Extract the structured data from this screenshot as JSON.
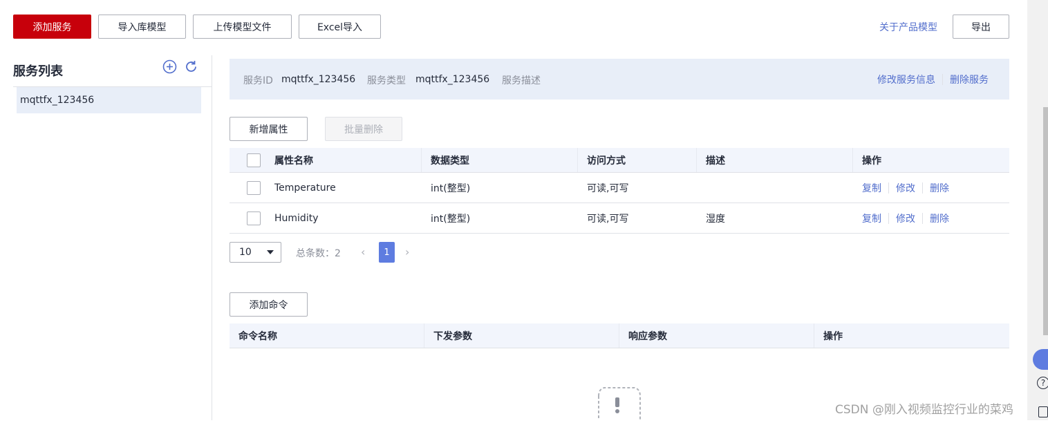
{
  "toolbar": {
    "add_service": "添加服务",
    "import_lib_model": "导入库模型",
    "upload_model_file": "上传模型文件",
    "excel_import": "Excel导入",
    "about_product_model": "关于产品模型",
    "export": "导出"
  },
  "sidebar": {
    "title": "服务列表",
    "items": [
      {
        "label": "mqttfx_123456"
      }
    ]
  },
  "service_info": {
    "id_label": "服务ID",
    "id_value": "mqttfx_123456",
    "type_label": "服务类型",
    "type_value": "mqttfx_123456",
    "desc_label": "服务描述",
    "edit_link": "修改服务信息",
    "delete_link": "删除服务"
  },
  "properties": {
    "add_button": "新增属性",
    "batch_delete_button": "批量删除",
    "columns": [
      "属性名称",
      "数据类型",
      "访问方式",
      "描述",
      "操作"
    ],
    "rows": [
      {
        "name": "Temperature",
        "type": "int(整型)",
        "access": "可读,可写",
        "desc": "",
        "ops": [
          "复制",
          "修改",
          "删除"
        ]
      },
      {
        "name": "Humidity",
        "type": "int(整型)",
        "access": "可读,可写",
        "desc": "湿度",
        "ops": [
          "复制",
          "修改",
          "删除"
        ]
      }
    ],
    "pagination": {
      "page_size": "10",
      "total_label": "总条数：2",
      "current_page": "1"
    }
  },
  "commands": {
    "add_button": "添加命令",
    "columns": [
      "命令名称",
      "下发参数",
      "响应参数",
      "操作"
    ]
  },
  "watermark": "CSDN @刚入视频监控行业的菜鸡",
  "colors": {
    "primary": "#c7000b",
    "link": "#526ecc",
    "header_bg": "#f2f5fc",
    "info_bg": "#e8eef8",
    "active_item": "#e8eef8",
    "page_active": "#5e7ce0"
  }
}
